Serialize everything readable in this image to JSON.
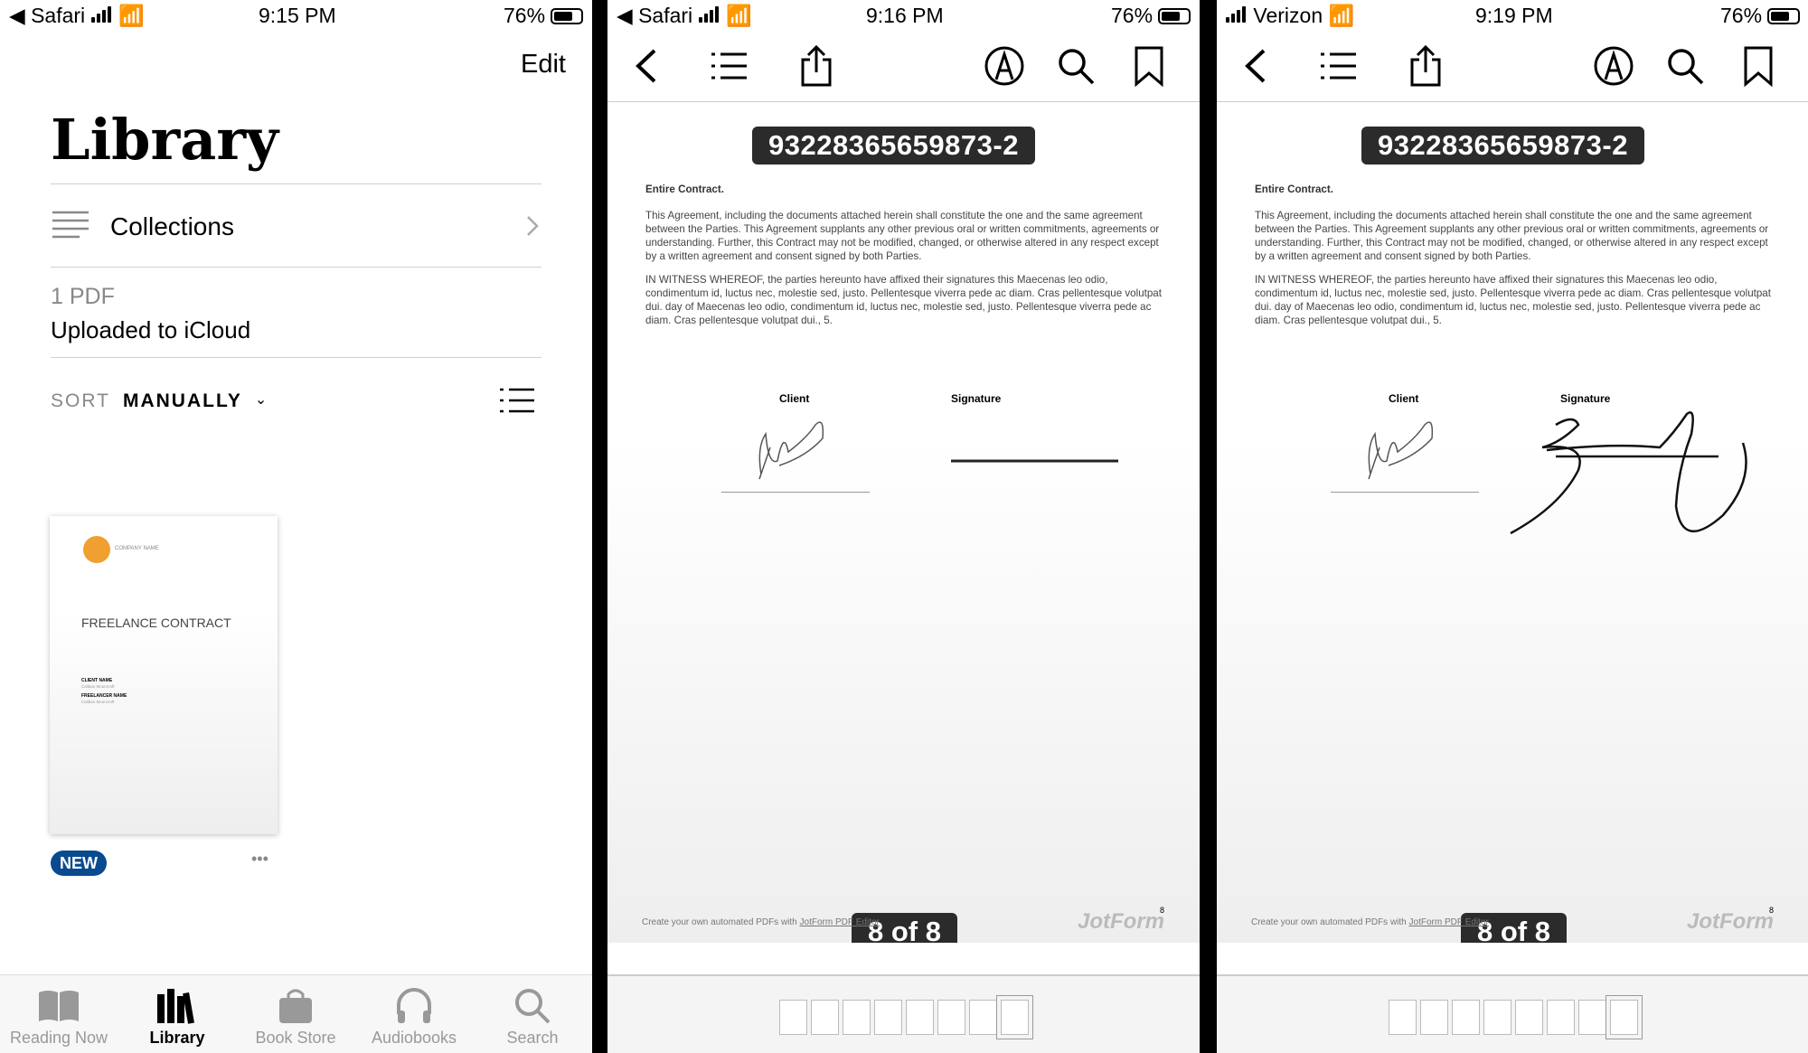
{
  "panel1": {
    "status": {
      "back_app": "Safari",
      "time": "9:15 PM",
      "battery": "76%"
    },
    "edit_label": "Edit",
    "title": "Library",
    "collections_label": "Collections",
    "count": "1 PDF",
    "upload_status": "Uploaded to iCloud",
    "sort_label": "SORT",
    "sort_value": "MANUALLY",
    "book": {
      "company": "COMPANY NAME",
      "title": "FREELANCE CONTRACT",
      "client_label": "CLIENT NAME",
      "client_value": "Caliban Mooncroft",
      "freelancer_label": "FREELANCER NAME",
      "freelancer_value": "Caliban Mooncroft",
      "badge": "NEW",
      "more": "•••"
    },
    "tabs": [
      {
        "label": "Reading Now",
        "icon": "book-open-icon"
      },
      {
        "label": "Library",
        "icon": "books-icon",
        "active": true
      },
      {
        "label": "Book Store",
        "icon": "bag-icon"
      },
      {
        "label": "Audiobooks",
        "icon": "headphones-icon"
      },
      {
        "label": "Search",
        "icon": "search-icon"
      }
    ]
  },
  "pdf": {
    "doc_id": "93228365659873-2",
    "heading": "Entire Contract.",
    "para1": "This Agreement, including the documents attached herein shall constitute the one and the same agreement between the Parties. This Agreement supplants any other previous oral or written commitments, agreements or understanding. Further, this Contract may not be modified, changed, or otherwise altered in any respect except by a written agreement and consent signed by both Parties.",
    "para2": "IN WITNESS WHEREOF, the parties hereunto have affixed their signatures this Maecenas leo odio, condimentum id, luctus nec, molestie sed, justo. Pellentesque viverra pede ac diam. Cras pellentesque volutpat dui. day of Maecenas leo odio, condimentum id, luctus nec, molestie sed, justo. Pellentesque viverra pede ac diam. Cras pellentesque volutpat dui., 5.",
    "client_label": "Client",
    "signature_label": "Signature",
    "footer_text": "Create your own automated PDFs with",
    "footer_link": "JotForm PDF Editor",
    "brand": "JotForm",
    "page_number": "8",
    "page_indicator": "8 of 8",
    "total_pages": 8
  },
  "panel2": {
    "status": {
      "back_app": "Safari",
      "time": "9:16 PM",
      "battery": "76%"
    }
  },
  "panel3": {
    "status": {
      "carrier": "Verizon",
      "time": "9:19 PM",
      "battery": "76%"
    }
  },
  "colors": {
    "accent": "#0a4a8f",
    "brand_orange": "#f0a030"
  }
}
